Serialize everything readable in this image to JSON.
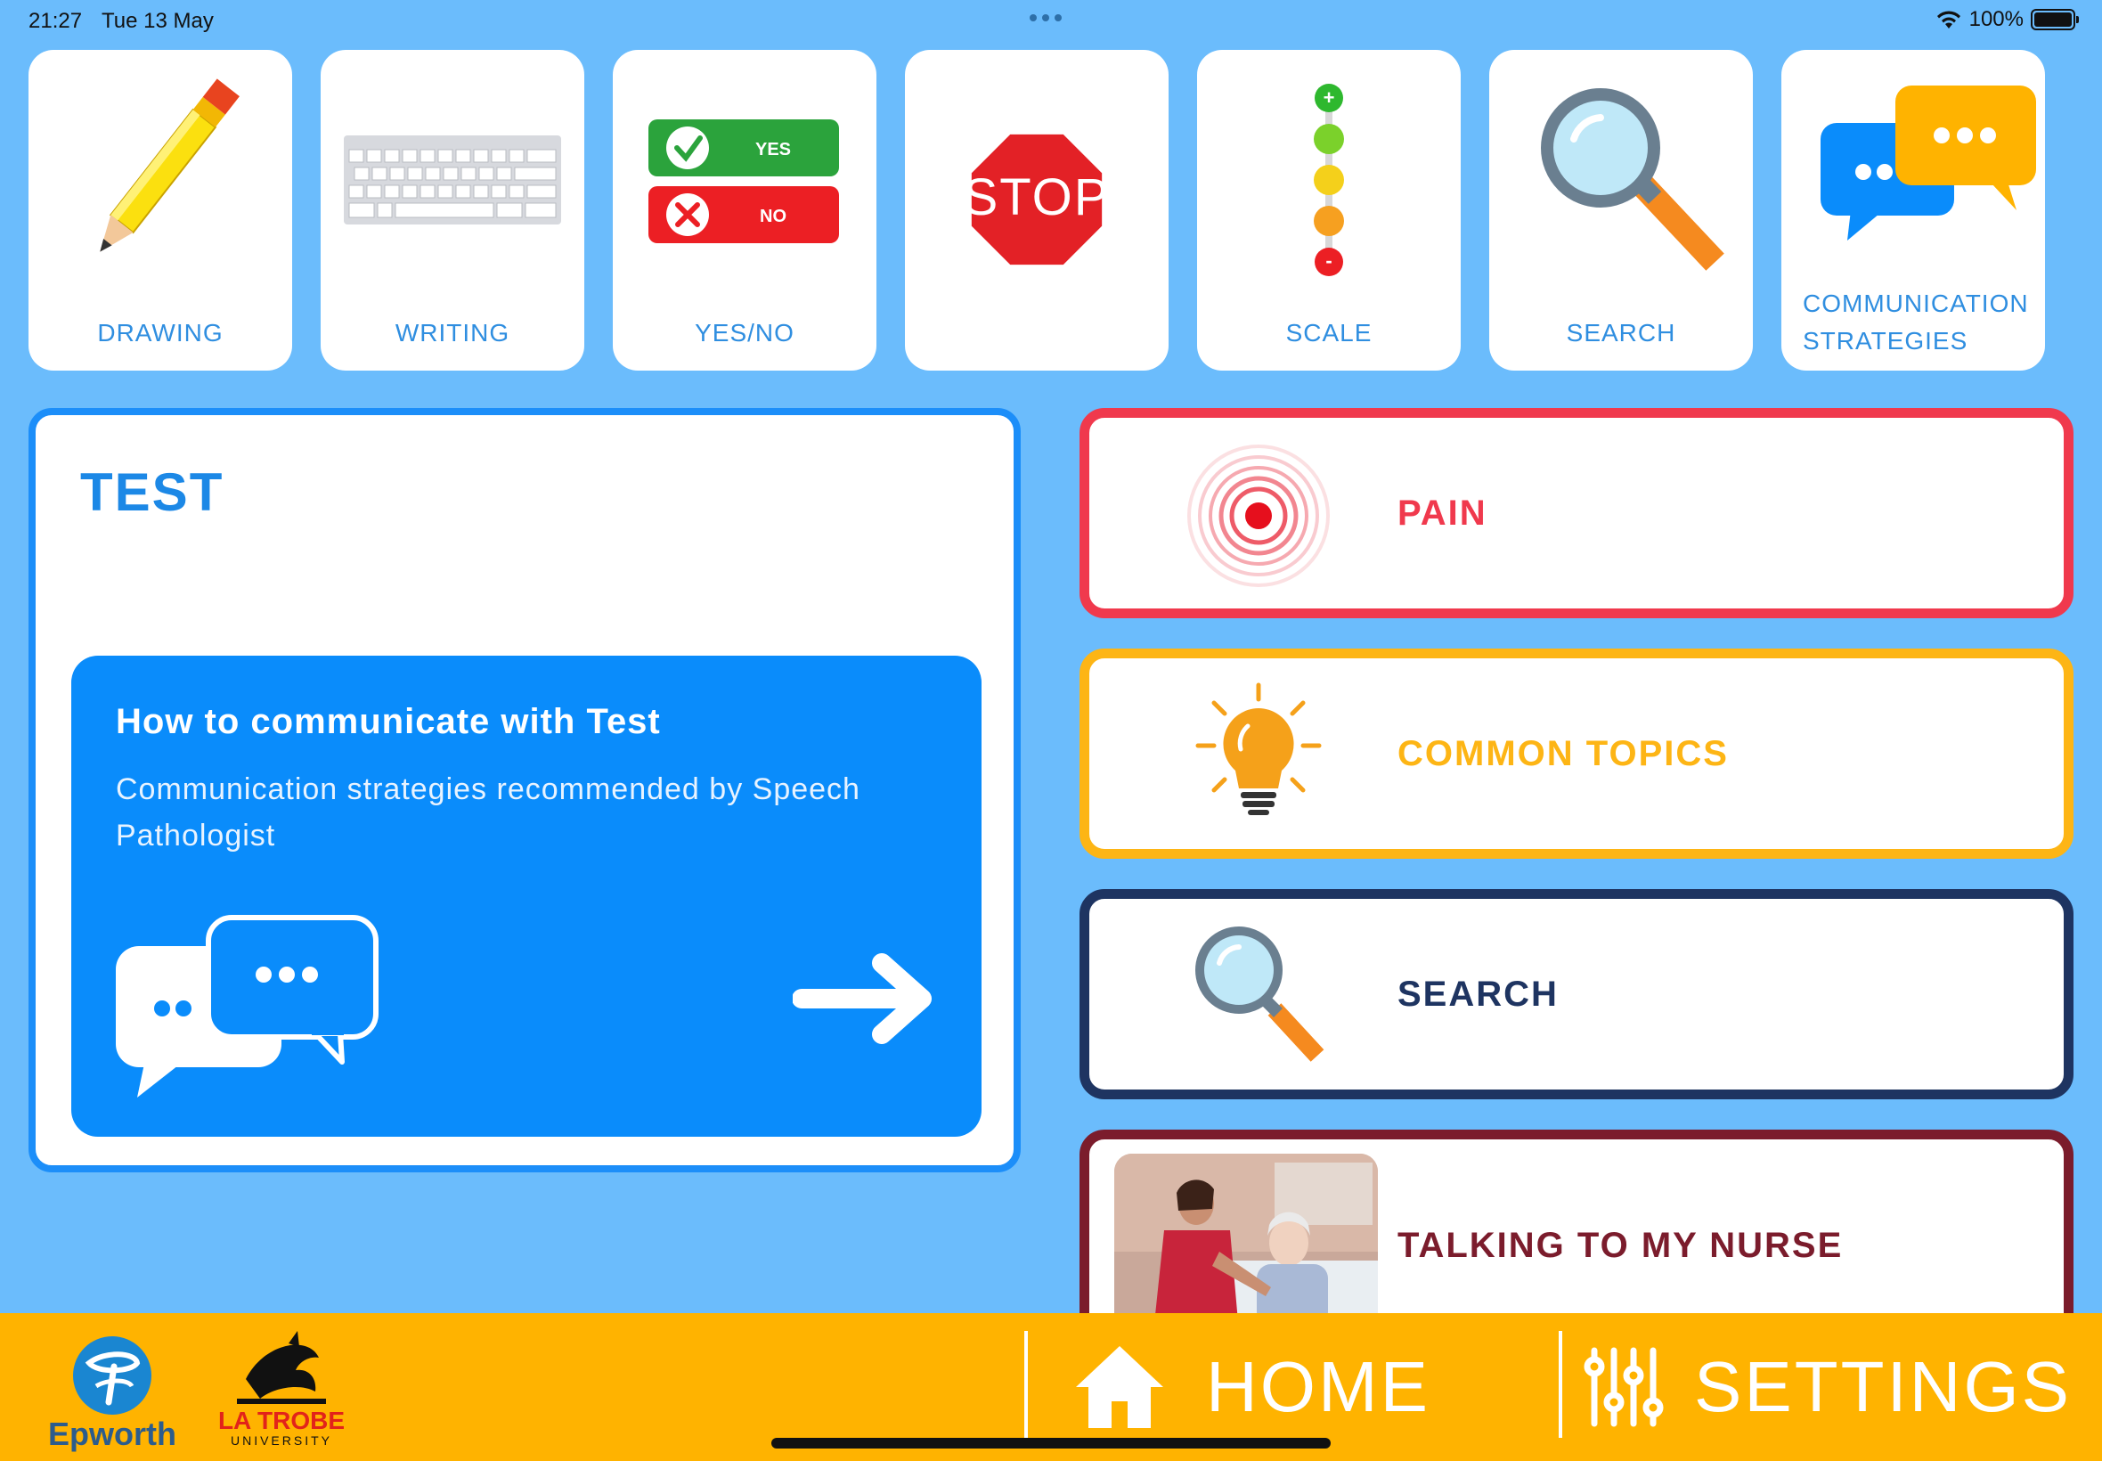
{
  "status_bar": {
    "time": "21:27",
    "date": "Tue 13 May",
    "battery": "100%"
  },
  "tiles": [
    {
      "label": "DRAWING",
      "icon": "pencil-icon"
    },
    {
      "label": "WRITING",
      "icon": "keyboard-icon"
    },
    {
      "label": "YES/NO",
      "icon": "yes-no-icon",
      "yes_text": "YES",
      "no_text": "NO"
    },
    {
      "label": "",
      "icon": "stop-sign-icon",
      "sign_text": "STOP"
    },
    {
      "label": "SCALE",
      "icon": "scale-icon"
    },
    {
      "label": "SEARCH",
      "icon": "magnifier-icon"
    },
    {
      "label": "COMMUNICATION STRATEGIES",
      "line1": "COMMUNICATION",
      "line2": "STRATEGIES",
      "icon": "chat-bubbles-icon"
    }
  ],
  "test_card": {
    "title": "TEST",
    "comm_title": "How to communicate with Test",
    "comm_desc": "Communication strategies recommended by Speech Pathologist"
  },
  "categories": [
    {
      "label": "PAIN",
      "color": "#f0394d",
      "icon": "pain-target-icon"
    },
    {
      "label": "COMMON TOPICS",
      "color": "#fdb515",
      "icon": "lightbulb-icon"
    },
    {
      "label": "SEARCH",
      "color": "#1e3461",
      "icon": "magnifier-icon"
    },
    {
      "label": "TALKING TO MY NURSE",
      "color": "#7b1c2c",
      "icon": "nurse-photo"
    }
  ],
  "bottom_bar": {
    "epworth": "Epworth",
    "latrobe_line1": "LA TROBE",
    "latrobe_line2": "UNIVERSITY",
    "home_label": "HOME",
    "settings_label": "SETTINGS",
    "bar_color": "#ffb300"
  },
  "colors": {
    "background": "#6bbcfc",
    "accent_blue": "#0a8cfb"
  }
}
